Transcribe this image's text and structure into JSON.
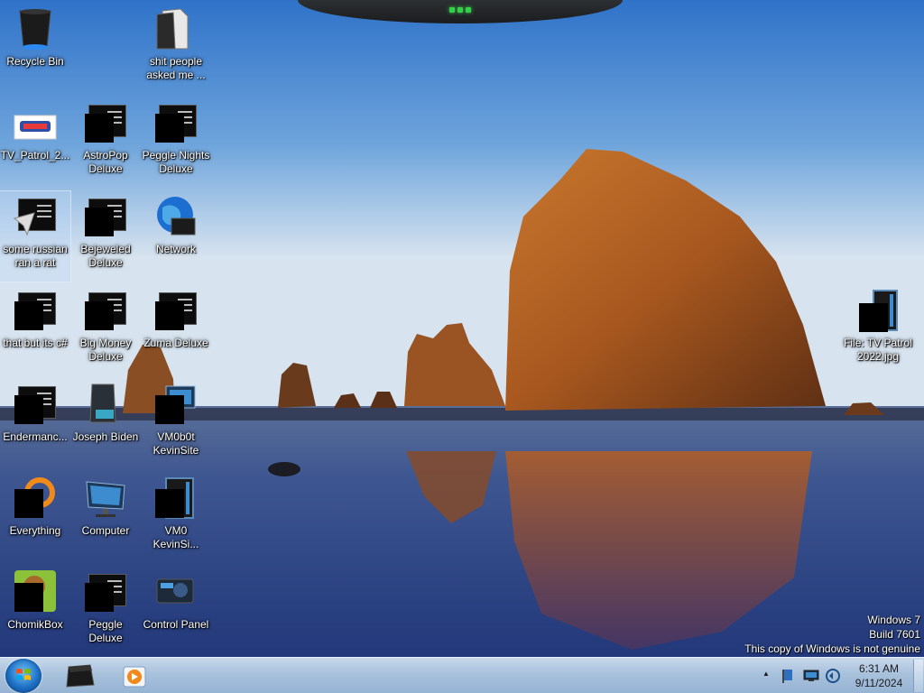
{
  "desktop_icons": [
    {
      "label": "Recycle Bin"
    },
    {
      "label": "shit people asked me ..."
    },
    {
      "label": "TV_Patrol_2..."
    },
    {
      "label": "AstroPop Deluxe"
    },
    {
      "label": "Peggle Nights Deluxe"
    },
    {
      "label": "some russian ran a rat"
    },
    {
      "label": "Bejeweled Deluxe"
    },
    {
      "label": "Network"
    },
    {
      "label": "that but its c#"
    },
    {
      "label": "Big Money Deluxe"
    },
    {
      "label": "Zuma Deluxe"
    },
    {
      "label": "File: TV Patrol 2022.jpg"
    },
    {
      "label": "Endermanc..."
    },
    {
      "label": "Joseph Biden"
    },
    {
      "label": "VM0b0t KevinSite"
    },
    {
      "label": "Everything"
    },
    {
      "label": "Computer"
    },
    {
      "label": "VM0 KevinSi..."
    },
    {
      "label": "ChomikBox"
    },
    {
      "label": "Peggle Deluxe"
    },
    {
      "label": "Control Panel"
    }
  ],
  "watermark": {
    "line1": "Windows 7",
    "line2": "Build 7601",
    "line3": "This copy of Windows is not genuine"
  },
  "taskbar": {
    "clock_time": "6:31 AM",
    "clock_date": "9/11/2024",
    "tray_arrow": "▲"
  }
}
